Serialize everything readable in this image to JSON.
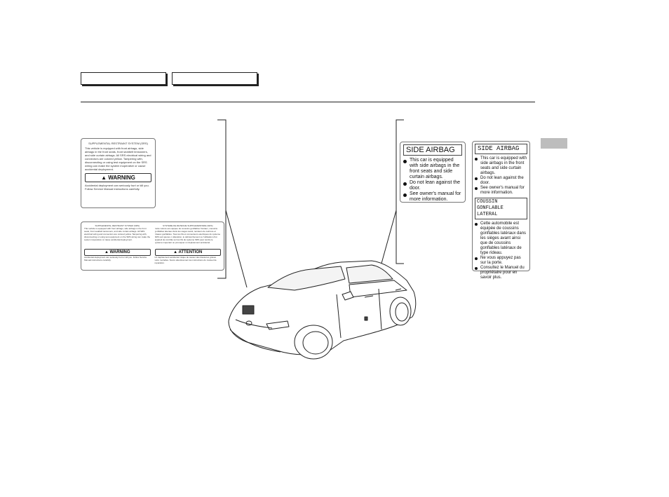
{
  "header": {
    "tabs": [
      "",
      ""
    ]
  },
  "srs_label": {
    "title": "SUPPLEMENTAL RESTRAINT SYSTEM (SRS)",
    "body": "This vehicle is equipped with front airbags, side airbags in the front seats, front seatbelt tensioners, and side curtain airbags. All SRS electrical wiring and connectors are colored yellow. Tampering with, disconnecting or using test equipment on the SRS wiring can make the system inoperative or cause accidental deployment.",
    "warning_title": "WARNING",
    "warning_text": "Accidental deployment can seriously hurt or kill you. Follow Service Manual instructions carefully."
  },
  "bilingual_label": {
    "left_title": "SUPPLEMENTAL RESTRAINT SYSTEM (SRS)",
    "left_body": "This vehicle is equipped with front airbags, side airbags in the front seats, front seatbelt tensioners, and side curtain airbags. All SRS electrical wiring and connectors are colored yellow. Tampering with, disconnecting or using test equipment on the SRS wiring can make the system inoperative or cause accidental deployment.",
    "left_warning_title": "WARNING",
    "left_warning_text": "Accidental deployment can seriously hurt or kill you. Follow Service Manual instructions carefully.",
    "right_title": "SYSTEME DE RETENUE SUPPLEMENTAIRE (SRS)",
    "right_body": "Cette voiture est equipee de coussins gonflables frontaux, coussins gonflables lateraux dans les sieges avant, tendeurs de ceinture et rideaux gonflables. Tous les fils et connecteurs electriques du systeme SRS sont jaunes. L'alteration, le debranchement ou l'utilisation d'un appareil de contrôle sur les fils du systeme SRS peut rendre le systeme inoperant ou provoquer un deploiement accidentel.",
    "right_warning_title": "ATTENTION",
    "right_warning_text": "Un deploiement accidentel risque de causer des blessures graves voire mortelles. Suivre attentivement les instructions du manuel de reparation."
  },
  "side_airbag_en": {
    "title": "SIDE AIRBAG",
    "items": [
      "This car is equipped with side airbags in the front seats and side curtain airbags.",
      "Do not lean against the door.",
      "See owner's manual for more information."
    ]
  },
  "side_airbag_bilingual": {
    "title": "SIDE AIRBAG",
    "items": [
      "This car is equipped with side airbags in the front seats and side curtain airbags.",
      "Do not lean against the door.",
      "See owner's manual for more information."
    ],
    "fr_title": "COUSSIN GONFLABLE LATERAL",
    "fr_items": [
      "Cette automobile est équipée de coussins gonflables latéraux dans les sièges avant ainsi que de coussins gonflables latéraux de type rideau.",
      "Ne vous appuyez pas sur la porte.",
      "Consultez le Manuel du propriétaire pour en savoir plus."
    ]
  }
}
